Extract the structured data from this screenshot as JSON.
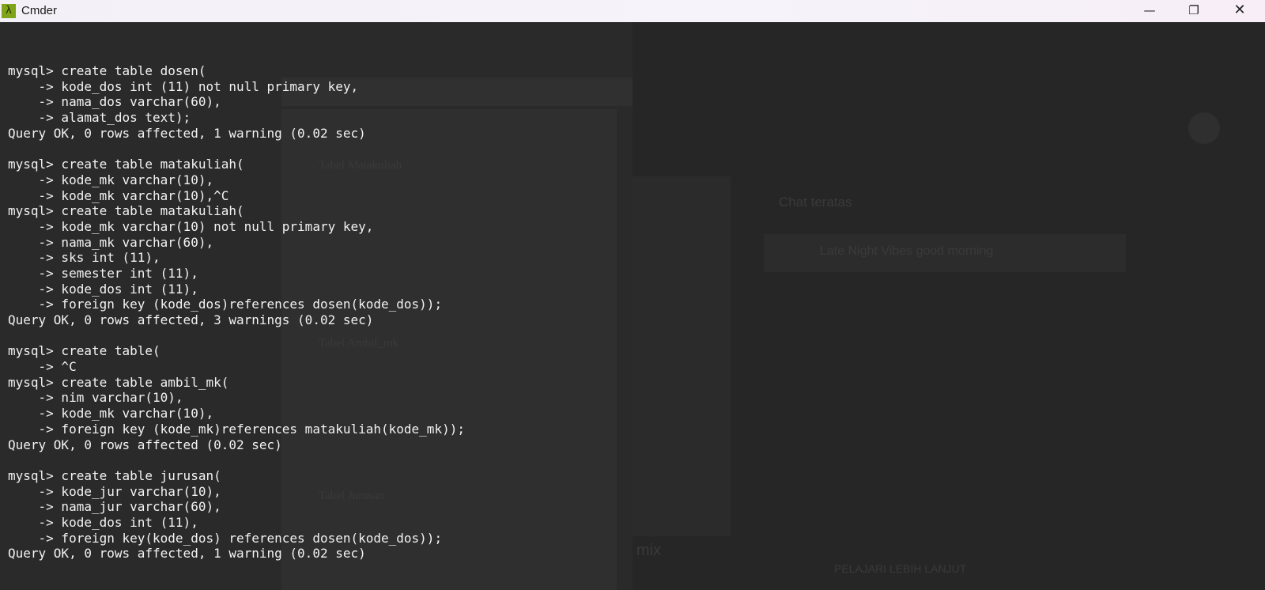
{
  "window": {
    "title": "Cmder",
    "app_icon": "λ",
    "buttons": {
      "minimize": "—",
      "maximize": "❐",
      "close": "✕"
    }
  },
  "background": {
    "doc_labels": [
      "Tabel Matakuliah",
      "Tabel Ambil_mk",
      "Tabel Jurusan"
    ],
    "chat_title": "Chat teratas",
    "banner_text": "Late Night Vibes  good morning",
    "footer": "PELAJARI LEBIH LANJUT",
    "mix_label": "mix"
  },
  "terminal": {
    "lines": [
      "mysql> create table dosen(",
      "    -> kode_dos int (11) not null primary key,",
      "    -> nama_dos varchar(60),",
      "    -> alamat_dos text);",
      "Query OK, 0 rows affected, 1 warning (0.02 sec)",
      "",
      "mysql> create table matakuliah(",
      "    -> kode_mk varchar(10),",
      "    -> kode_mk varchar(10),^C",
      "mysql> create table matakuliah(",
      "    -> kode_mk varchar(10) not null primary key,",
      "    -> nama_mk varchar(60),",
      "    -> sks int (11),",
      "    -> semester int (11),",
      "    -> kode_dos int (11),",
      "    -> foreign key (kode_dos)references dosen(kode_dos));",
      "Query OK, 0 rows affected, 3 warnings (0.02 sec)",
      "",
      "mysql> create table(",
      "    -> ^C",
      "mysql> create table ambil_mk(",
      "    -> nim varchar(10),",
      "    -> kode_mk varchar(10),",
      "    -> foreign key (kode_mk)references matakuliah(kode_mk));",
      "Query OK, 0 rows affected (0.02 sec)",
      "",
      "mysql> create table jurusan(",
      "    -> kode_jur varchar(10),",
      "    -> nama_jur varchar(60),",
      "    -> kode_dos int (11),",
      "    -> foreign key(kode_dos) references dosen(kode_dos));",
      "Query OK, 0 rows affected, 1 warning (0.02 sec)"
    ]
  }
}
